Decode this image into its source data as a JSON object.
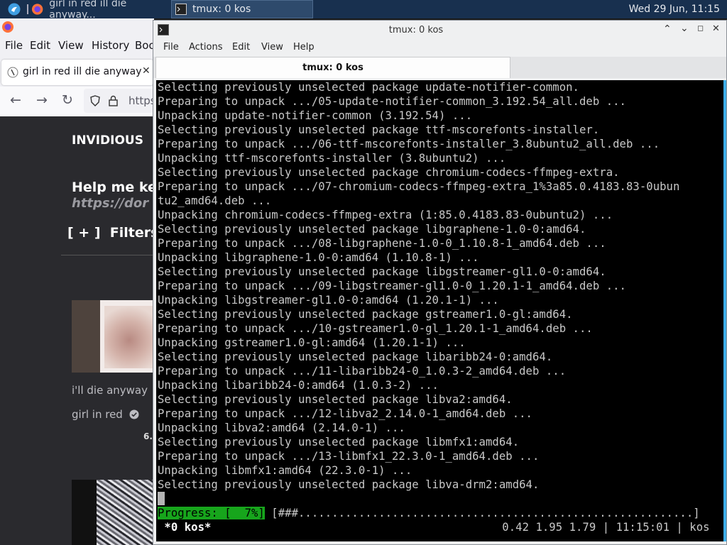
{
  "panel": {
    "ff_task_label": "girl in red ill die anyway...",
    "term_task_label": "tmux: 0 kos",
    "clock": "Wed 29 Jun, 11:15"
  },
  "firefox": {
    "menu": [
      "File",
      "Edit",
      "View",
      "History",
      "Boo"
    ],
    "tab_title": "girl in red ill die anyway",
    "url_partial": "https",
    "brand": "INVIDIOUS",
    "help_text": "Help me ke",
    "link_text": "https://dor",
    "filters": "[ + ]  Filters",
    "video_title": "i'll die anyway",
    "channel": "girl in red",
    "views_partial": "6."
  },
  "terminal": {
    "title": "tmux: 0 kos",
    "menu": [
      "File",
      "Actions",
      "Edit",
      "View",
      "Help"
    ],
    "tab_title": "tmux: 0 kos",
    "lines": [
      "Selecting previously unselected package update-notifier-common.",
      "Preparing to unpack .../05-update-notifier-common_3.192.54_all.deb ...",
      "Unpacking update-notifier-common (3.192.54) ...",
      "Selecting previously unselected package ttf-mscorefonts-installer.",
      "Preparing to unpack .../06-ttf-mscorefonts-installer_3.8ubuntu2_all.deb ...",
      "Unpacking ttf-mscorefonts-installer (3.8ubuntu2) ...",
      "Selecting previously unselected package chromium-codecs-ffmpeg-extra.",
      "Preparing to unpack .../07-chromium-codecs-ffmpeg-extra_1%3a85.0.4183.83-0ubun",
      "tu2_amd64.deb ...",
      "Unpacking chromium-codecs-ffmpeg-extra (1:85.0.4183.83-0ubuntu2) ...",
      "Selecting previously unselected package libgraphene-1.0-0:amd64.",
      "Preparing to unpack .../08-libgraphene-1.0-0_1.10.8-1_amd64.deb ...",
      "Unpacking libgraphene-1.0-0:amd64 (1.10.8-1) ...",
      "Selecting previously unselected package libgstreamer-gl1.0-0:amd64.",
      "Preparing to unpack .../09-libgstreamer-gl1.0-0_1.20.1-1_amd64.deb ...",
      "Unpacking libgstreamer-gl1.0-0:amd64 (1.20.1-1) ...",
      "Selecting previously unselected package gstreamer1.0-gl:amd64.",
      "Preparing to unpack .../10-gstreamer1.0-gl_1.20.1-1_amd64.deb ...",
      "Unpacking gstreamer1.0-gl:amd64 (1.20.1-1) ...",
      "Selecting previously unselected package libaribb24-0:amd64.",
      "Preparing to unpack .../11-libaribb24-0_1.0.3-2_amd64.deb ...",
      "Unpacking libaribb24-0:amd64 (1.0.3-2) ...",
      "Selecting previously unselected package libva2:amd64.",
      "Preparing to unpack .../12-libva2_2.14.0-1_amd64.deb ...",
      "Unpacking libva2:amd64 (2.14.0-1) ...",
      "Selecting previously unselected package libmfx1:amd64.",
      "Preparing to unpack .../13-libmfx1_22.3.0-1_amd64.deb ...",
      "Unpacking libmfx1:amd64 (22.3.0-1) ...",
      "Selecting previously unselected package libva-drm2:amd64."
    ],
    "progress_label": "Progress: [  7%]",
    "progress_bar": " [###...........................................................]",
    "progress_percent": 7,
    "status_left": " *0 kos*",
    "status_right": "0.42 1.95 1.79 | 11:15:01 | kos "
  },
  "colors": {
    "panel_bg": "#18304f",
    "progress_green": "#17a51c",
    "terminal_bg": "#000000",
    "terminal_fg": "#c8c8c8"
  }
}
